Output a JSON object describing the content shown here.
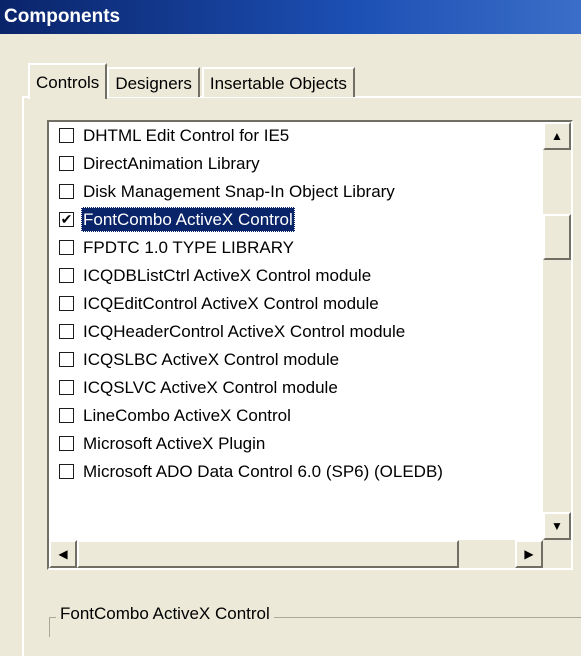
{
  "window": {
    "title": "Components"
  },
  "tabs": [
    {
      "label": "Controls"
    },
    {
      "label": "Designers"
    },
    {
      "label": "Insertable Objects"
    }
  ],
  "list": {
    "items": [
      {
        "label": "DHTML Edit Control for IE5",
        "checked": false,
        "selected": false
      },
      {
        "label": "DirectAnimation Library",
        "checked": false,
        "selected": false
      },
      {
        "label": "Disk Management Snap-In Object Library",
        "checked": false,
        "selected": false
      },
      {
        "label": "FontCombo ActiveX Control",
        "checked": true,
        "selected": true
      },
      {
        "label": "FPDTC 1.0 TYPE LIBRARY",
        "checked": false,
        "selected": false
      },
      {
        "label": "ICQDBListCtrl ActiveX Control module",
        "checked": false,
        "selected": false
      },
      {
        "label": "ICQEditControl ActiveX Control module",
        "checked": false,
        "selected": false
      },
      {
        "label": "ICQHeaderControl ActiveX Control module",
        "checked": false,
        "selected": false
      },
      {
        "label": "ICQSLBC ActiveX Control module",
        "checked": false,
        "selected": false
      },
      {
        "label": "ICQSLVC ActiveX Control module",
        "checked": false,
        "selected": false
      },
      {
        "label": "LineCombo ActiveX Control",
        "checked": false,
        "selected": false
      },
      {
        "label": "Microsoft ActiveX Plugin",
        "checked": false,
        "selected": false
      },
      {
        "label": "Microsoft ADO Data Control 6.0 (SP6) (OLEDB)",
        "checked": false,
        "selected": false
      }
    ]
  },
  "groupbox": {
    "label": "FontCombo ActiveX Control"
  },
  "icons": {
    "check": "✔",
    "scroll_up": "▲",
    "scroll_down": "▼",
    "scroll_left": "◀",
    "scroll_right": "▶"
  },
  "colors": {
    "titlebar": "#0a246a",
    "selection": "#0a246a",
    "face": "#ece9d8"
  }
}
